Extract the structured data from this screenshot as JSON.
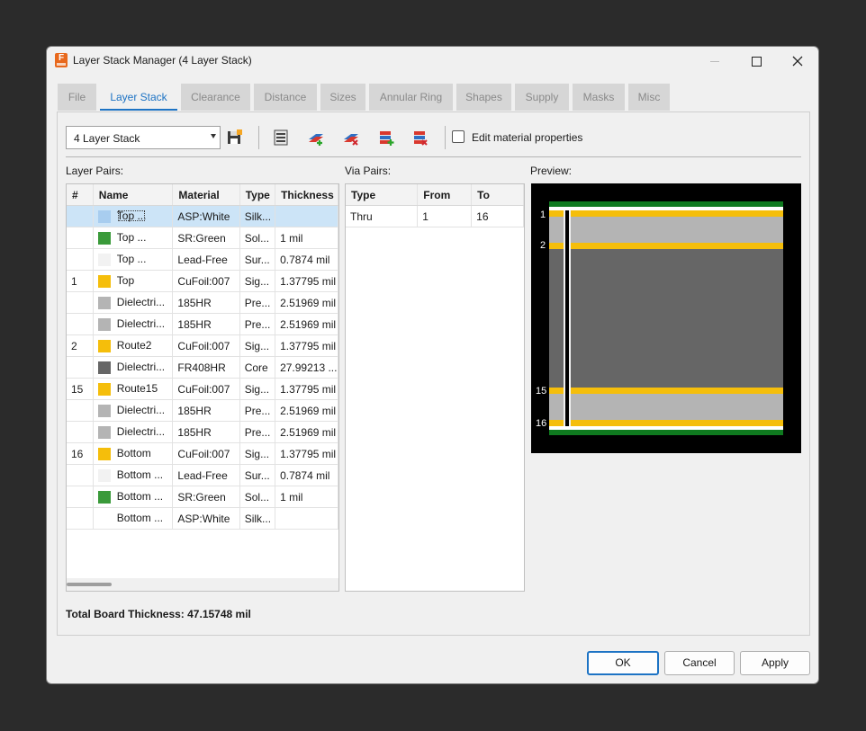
{
  "window": {
    "title": "Layer Stack Manager (4 Layer Stack)"
  },
  "tabs": [
    {
      "label": "File",
      "active": false
    },
    {
      "label": "Layer Stack",
      "active": true
    },
    {
      "label": "Clearance",
      "active": false
    },
    {
      "label": "Distance",
      "active": false
    },
    {
      "label": "Sizes",
      "active": false
    },
    {
      "label": "Annular Ring",
      "active": false
    },
    {
      "label": "Shapes",
      "active": false
    },
    {
      "label": "Supply",
      "active": false
    },
    {
      "label": "Masks",
      "active": false
    },
    {
      "label": "Misc",
      "active": false
    }
  ],
  "toolbar": {
    "stack_selected": "4 Layer Stack",
    "edit_material_label": "Edit material properties",
    "edit_material_checked": false
  },
  "layer_pairs": {
    "label": "Layer Pairs:",
    "columns": [
      "#",
      "Name",
      "Material",
      "Type",
      "Thickness"
    ],
    "rows": [
      {
        "num": "",
        "color": "#a8cdef",
        "name": "Top ...",
        "material": "ASP:White",
        "type": "Silk...",
        "thickness": "",
        "selected": true
      },
      {
        "num": "",
        "color": "#3a9a3a",
        "name": "Top ...",
        "material": "SR:Green",
        "type": "Sol...",
        "thickness": "1 mil"
      },
      {
        "num": "",
        "color": "#f2f2f2",
        "name": "Top ...",
        "material": "Lead-Free",
        "type": "Sur...",
        "thickness": "0.7874 mil"
      },
      {
        "num": "1",
        "color": "#f5be0b",
        "name": "Top",
        "material": "CuFoil:007",
        "type": "Sig...",
        "thickness": "1.37795 mil"
      },
      {
        "num": "",
        "color": "#b4b4b4",
        "name": "Dielectri...",
        "material": "185HR",
        "type": "Pre...",
        "thickness": "2.51969 mil"
      },
      {
        "num": "",
        "color": "#b4b4b4",
        "name": "Dielectri...",
        "material": "185HR",
        "type": "Pre...",
        "thickness": "2.51969 mil"
      },
      {
        "num": "2",
        "color": "#f5be0b",
        "name": "Route2",
        "material": "CuFoil:007",
        "type": "Sig...",
        "thickness": "1.37795 mil"
      },
      {
        "num": "",
        "color": "#666666",
        "name": "Dielectri...",
        "material": "FR408HR",
        "type": "Core",
        "thickness": "27.99213 ..."
      },
      {
        "num": "15",
        "color": "#f5be0b",
        "name": "Route15",
        "material": "CuFoil:007",
        "type": "Sig...",
        "thickness": "1.37795 mil"
      },
      {
        "num": "",
        "color": "#b4b4b4",
        "name": "Dielectri...",
        "material": "185HR",
        "type": "Pre...",
        "thickness": "2.51969 mil"
      },
      {
        "num": "",
        "color": "#b4b4b4",
        "name": "Dielectri...",
        "material": "185HR",
        "type": "Pre...",
        "thickness": "2.51969 mil"
      },
      {
        "num": "16",
        "color": "#f5be0b",
        "name": "Bottom",
        "material": "CuFoil:007",
        "type": "Sig...",
        "thickness": "1.37795 mil"
      },
      {
        "num": "",
        "color": "#f2f2f2",
        "name": "Bottom ...",
        "material": "Lead-Free",
        "type": "Sur...",
        "thickness": "0.7874 mil"
      },
      {
        "num": "",
        "color": "#3a9a3a",
        "name": "Bottom ...",
        "material": "SR:Green",
        "type": "Sol...",
        "thickness": "1 mil"
      },
      {
        "num": "",
        "color": "#ffffff",
        "name": "Bottom ...",
        "material": "ASP:White",
        "type": "Silk...",
        "thickness": ""
      }
    ]
  },
  "via_pairs": {
    "label": "Via Pairs:",
    "columns": [
      "Type",
      "From",
      "To"
    ],
    "rows": [
      {
        "type": "Thru",
        "from": "1",
        "to": "16"
      }
    ]
  },
  "preview": {
    "label": "Preview:",
    "layer_labels": [
      "1",
      "2",
      "15",
      "16"
    ]
  },
  "total_thickness": "Total Board Thickness: 47.15748 mil",
  "buttons": {
    "ok": "OK",
    "cancel": "Cancel",
    "apply": "Apply"
  },
  "colors": {
    "accent": "#1d73c4",
    "copper": "#f5be0b",
    "soldermask": "#0f7a1f",
    "prepreg": "#b4b4b4",
    "core": "#666666"
  }
}
